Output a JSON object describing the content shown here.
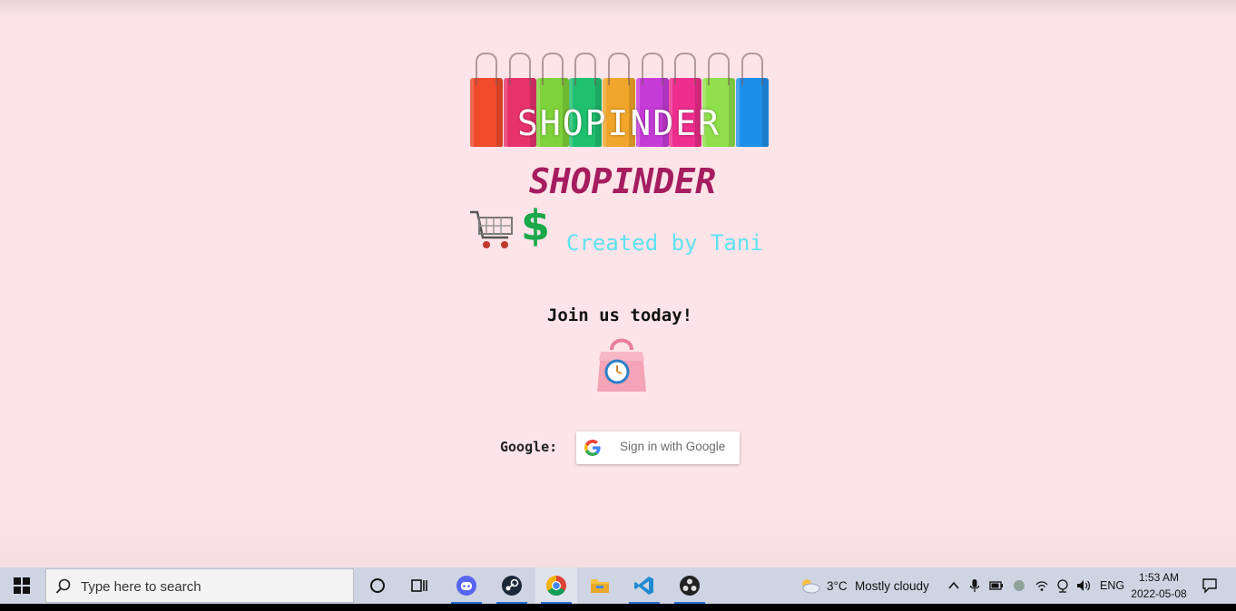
{
  "banner": {
    "text": "SHOPINDER"
  },
  "title": "SHOPINDER",
  "tagline": "Created by Tani",
  "join": "Join us today!",
  "auth": {
    "google_label": "Google:",
    "google_button": "Sign in with Google"
  },
  "taskbar": {
    "search_placeholder": "Type here to search",
    "apps": [
      "cortana-icon",
      "task-view-icon",
      "discord-icon",
      "steam-icon",
      "chrome-icon",
      "file-explorer-icon",
      "vscode-icon",
      "obs-icon"
    ],
    "weather": {
      "temp": "3°C",
      "condition": "Mostly cloudy"
    },
    "language": "ENG",
    "time": "1:53 AM",
    "date": "2022-05-08"
  },
  "colors": {
    "page_bg": "#fde4e8",
    "title": "#a51c5f",
    "tagline": "#5fe2f0",
    "dollar": "#1aa84a",
    "taskbar_bg": "#cfd4e3"
  }
}
